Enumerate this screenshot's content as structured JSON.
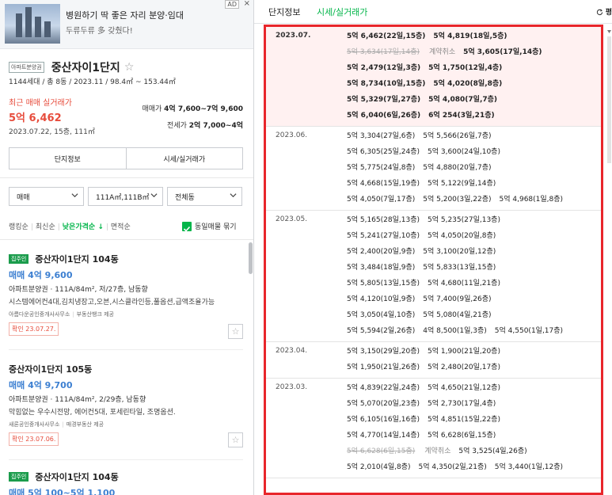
{
  "ad": {
    "title": "병원하기 딱 좋은 자리 분양·임대",
    "subtitle": "두류두류 多 갖췄다!",
    "badge": "AD",
    "close": "×"
  },
  "complex": {
    "type_badge": "아파트분양권",
    "name": "중산자이1단지",
    "star": "☆",
    "info": "1144세대 / 총 8동 / 2023.11 / 98.4㎡ ~ 153.44㎡",
    "recent_label": "최근 매매 실거래가",
    "recent_price": "5억 6,462",
    "recent_date": "2023.07.22, 15층, 111㎡",
    "sale_label": "매매가",
    "sale_range": "4억 7,600~7억 9,600",
    "rent_label": "전세가",
    "rent_range": "2억 7,000~4억"
  },
  "buttons": {
    "info": "단지정보",
    "price": "시세/실거래가"
  },
  "filters": {
    "trade": "매매",
    "area": "111A㎡,111B㎡",
    "dong": "전체동"
  },
  "sort": {
    "items": [
      "랭킹순",
      "최신순",
      "낮은가격순 ↓",
      "면적순"
    ],
    "active_index": 2,
    "same_listing": "동일매물 묶기"
  },
  "listings": [
    {
      "tag": "집주인",
      "name": "중산자이1단지 104동",
      "price": "매매 4억 9,600",
      "spec": "아파트분양권 · 111A/84m², 저/27층, 남동향",
      "desc": "시스템에어컨4대,김치냉장고,오븐,시스클라인등,풀옵션,급액조율가능",
      "agent": "아름다운공인중개사사무소",
      "agent2": "부동산뱅크 제공",
      "confirm": "확인 23.07.27."
    },
    {
      "tag": "",
      "name": "중산자이1단지 105동",
      "price": "매매 4억 9,700",
      "spec": "아파트분양권 · 111A/84m², 2/29층, 남동향",
      "desc": "막힘없는 우수시전망, 에어컨5대, 포세린타일, 조명옵션.",
      "agent": "새론공인중개사사무소",
      "agent2": "매경부동산 제공",
      "confirm": "확인 23.07.06."
    },
    {
      "tag": "집주인",
      "name": "중산자이1단지 104동",
      "price": "매매 5억 100~5억 1,100"
    }
  ],
  "tabs": {
    "info": "단지정보",
    "price": "시세/실거래가",
    "refresh": "평"
  },
  "transactions": [
    {
      "month": "2023.07.",
      "highlight": true,
      "rows": [
        [
          {
            "t": "5억 6,462(22일,15층)"
          },
          {
            "t": "5억 4,819(18일,5층)"
          }
        ],
        [
          {
            "t": "5억 3,634(17일,14층)",
            "c": true
          },
          {
            "n": "계약취소"
          },
          {
            "t": "5억 3,605(17일,14층)"
          }
        ],
        [
          {
            "t": "5억 2,479(12일,3층)"
          },
          {
            "t": "5억 1,750(12일,4층)"
          }
        ],
        [
          {
            "t": "5억 8,734(10일,15층)"
          },
          {
            "t": "5억 4,020(8일,8층)"
          }
        ],
        [
          {
            "t": "5억 5,329(7일,27층)"
          },
          {
            "t": "5억 4,080(7일,7층)"
          }
        ],
        [
          {
            "t": "5억 6,040(6일,26층)"
          },
          {
            "t": "6억 254(3일,21층)"
          }
        ]
      ]
    },
    {
      "month": "2023.06.",
      "highlight": false,
      "rows": [
        [
          {
            "t": "5억 3,304(27일,6층)"
          },
          {
            "t": "5억 5,566(26일,7층)"
          }
        ],
        [
          {
            "t": "5억 6,305(25일,24층)"
          },
          {
            "t": "5억 3,600(24일,10층)"
          }
        ],
        [
          {
            "t": "5억 5,775(24일,8층)"
          },
          {
            "t": "5억 4,880(20일,7층)"
          }
        ],
        [
          {
            "t": "5억 4,668(15일,19층)"
          },
          {
            "t": "5억 5,122(9일,14층)"
          }
        ],
        [
          {
            "t": "5억 4,050(7일,17층)"
          },
          {
            "t": "5억 5,200(3일,22층)"
          },
          {
            "t": "5억 4,968(1일,8층)"
          }
        ]
      ]
    },
    {
      "month": "2023.05.",
      "highlight": false,
      "rows": [
        [
          {
            "t": "5억 5,165(28일,13층)"
          },
          {
            "t": "5억 5,235(27일,13층)"
          }
        ],
        [
          {
            "t": "5억 5,241(27일,10층)"
          },
          {
            "t": "5억 4,050(20일,8층)"
          }
        ],
        [
          {
            "t": "5억 2,400(20일,9층)"
          },
          {
            "t": "5억 3,100(20일,12층)"
          }
        ],
        [
          {
            "t": "5억 3,484(18일,9층)"
          },
          {
            "t": "5억 5,833(13일,15층)"
          }
        ],
        [
          {
            "t": "5억 5,805(13일,15층)"
          },
          {
            "t": "5억 4,680(11일,21층)"
          }
        ],
        [
          {
            "t": "5억 4,120(10일,9층)"
          },
          {
            "t": "5억 7,400(9일,26층)"
          }
        ],
        [
          {
            "t": "5억 3,050(4일,10층)"
          },
          {
            "t": "5억 5,080(4일,21층)"
          }
        ],
        [
          {
            "t": "5억 5,594(2일,26층)"
          },
          {
            "t": "4억 8,500(1일,3층)"
          },
          {
            "t": "5억 4,550(1일,17층)"
          }
        ]
      ]
    },
    {
      "month": "2023.04.",
      "highlight": false,
      "rows": [
        [
          {
            "t": "5억 3,150(29일,20층)"
          },
          {
            "t": "5억 1,900(21일,20층)"
          }
        ],
        [
          {
            "t": "5억 1,950(21일,26층)"
          },
          {
            "t": "5억 2,480(20일,17층)"
          }
        ]
      ]
    },
    {
      "month": "2023.03.",
      "highlight": false,
      "rows": [
        [
          {
            "t": "5억 4,839(22일,24층)"
          },
          {
            "t": "5억 4,650(21일,12층)"
          }
        ],
        [
          {
            "t": "5억 5,070(20일,23층)"
          },
          {
            "t": "5억 2,730(17일,4층)"
          }
        ],
        [
          {
            "t": "5억 6,105(16일,16층)"
          },
          {
            "t": "5억 4,851(15일,22층)"
          }
        ],
        [
          {
            "t": "5억 4,770(14일,14층)"
          },
          {
            "t": "5억 6,628(6일,15층)"
          }
        ],
        [
          {
            "t": "5억 6,628(6일,15층)",
            "c": true
          },
          {
            "n": "계약취소"
          },
          {
            "t": "5억 3,525(4일,26층)"
          }
        ],
        [
          {
            "t": "5억 2,010(4일,8층)"
          },
          {
            "t": "5억 4,350(2일,21층)"
          },
          {
            "t": "5억 3,440(1일,12층)"
          }
        ]
      ]
    }
  ],
  "colors": {
    "accent_green": "#03b54a",
    "price_red": "#e74c3c",
    "price_blue": "#3c7fd1",
    "highlight_border": "#e8262b"
  }
}
